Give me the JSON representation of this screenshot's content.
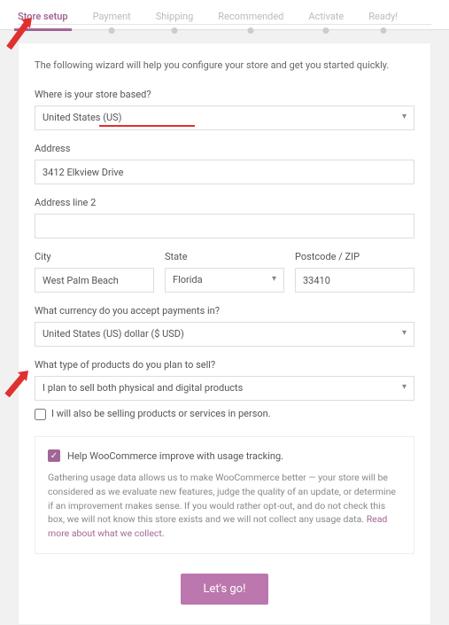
{
  "steps": [
    "Store setup",
    "Payment",
    "Shipping",
    "Recommended",
    "Activate",
    "Ready!"
  ],
  "intro": "The following wizard will help you configure your store and get you started quickly.",
  "store_based_label": "Where is your store based?",
  "store_based_value": "United States (US)",
  "address_label": "Address",
  "address_value": "3412 Elkview Drive",
  "address2_label": "Address line 2",
  "address2_value": "",
  "city_label": "City",
  "city_value": "West Palm Beach",
  "state_label": "State",
  "state_value": "Florida",
  "zip_label": "Postcode / ZIP",
  "zip_value": "33410",
  "currency_label": "What currency do you accept payments in?",
  "currency_value": "United States (US) dollar ($ USD)",
  "product_type_label": "What type of products do you plan to sell?",
  "product_type_value": "I plan to sell both physical and digital products",
  "in_person_label": "I will also be selling products or services in person.",
  "tracking_title": "Help WooCommerce improve with usage tracking.",
  "tracking_body_1": "Gathering usage data allows us to make WooCommerce better — your store will be considered as we evaluate new features, judge the quality of an update, or determine if an improvement makes sense. If you would rather opt-out, and do not check this box, we will not know this store exists and we will not collect any usage data. ",
  "tracking_link": "Read more about what we collect.",
  "button": "Let's go!"
}
